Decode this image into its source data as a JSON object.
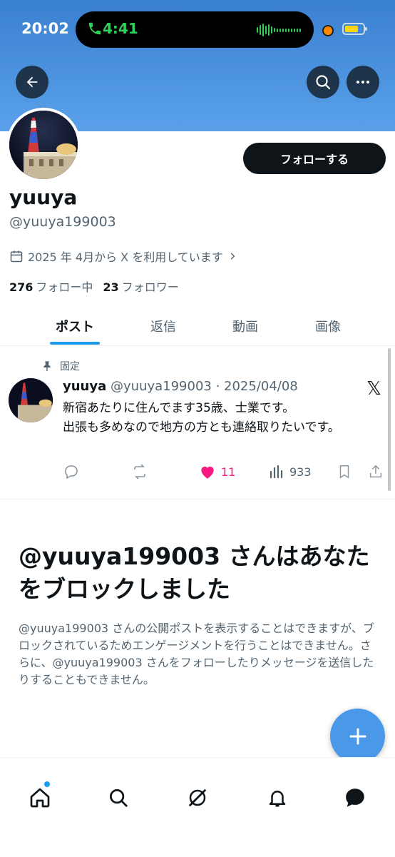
{
  "status_bar": {
    "time": "20:02",
    "call_timer": "4:41",
    "accent_call": "#30d158",
    "battery_color": "#ffd60a"
  },
  "banner": {
    "color": "#4a90e2"
  },
  "header": {
    "back_icon": "arrow-left-icon",
    "search_icon": "search-icon",
    "more_icon": "more-horizontal-icon"
  },
  "profile": {
    "display_name": "yuuya",
    "handle": "@yuuya199003",
    "joined": "2025 年 4月から X を利用しています",
    "follow_button": "フォローする",
    "following_count": "276",
    "following_label": "フォロー中",
    "followers_count": "23",
    "followers_label": "フォロワー"
  },
  "tabs": [
    {
      "label": "ポスト",
      "active": true
    },
    {
      "label": "返信",
      "active": false
    },
    {
      "label": "動画",
      "active": false
    },
    {
      "label": "画像",
      "active": false
    }
  ],
  "pinned_post": {
    "pinned_label": "固定",
    "author_name": "yuuya",
    "meta": "@yuuya199003 · 2025/04/08",
    "text_line1": "新宿あたりに住んでます35歳、士業です。",
    "text_line2": "出張も多めなので地方の方とも連絡取りたいです。",
    "likes": "11",
    "views": "933",
    "like_color": "#f91880"
  },
  "block_notice": {
    "title": "@yuuya199003 さんはあなたをブロックしました",
    "description": "@yuuya199003 さんの公開ポストを表示することはできますが、ブロックされているためエンゲージメントを行うことはできません。さらに、@yuuya199003 さんをフォローしたりメッセージを送信したりすることもできません。"
  },
  "fab": {
    "icon": "plus-icon",
    "color": "#4a99e9"
  },
  "bottom_nav": [
    "home-icon",
    "search-icon",
    "grok-icon",
    "notifications-icon",
    "messages-icon"
  ]
}
